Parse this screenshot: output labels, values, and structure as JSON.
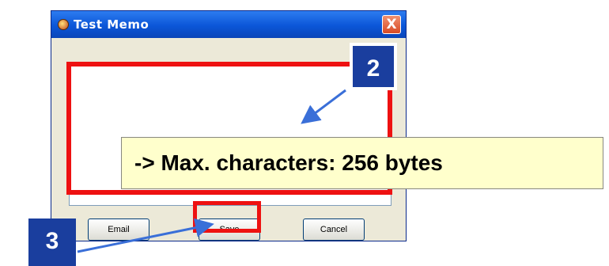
{
  "window": {
    "title": "Test Memo",
    "close_label": "X"
  },
  "buttons": {
    "email": "Email",
    "save": "Save",
    "cancel": "Cancel"
  },
  "annotations": {
    "badge_2": "2",
    "badge_3": "3",
    "callout": "-> Max. characters: 256 bytes"
  },
  "colors": {
    "highlight": "#ee1111",
    "badge": "#1a3e9e",
    "callout_bg": "#ffffcc",
    "titlebar": "#0b56d8"
  }
}
